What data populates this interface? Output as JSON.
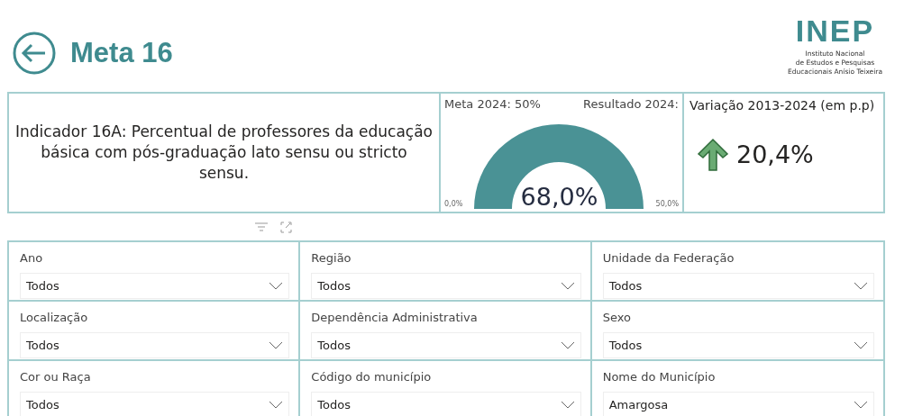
{
  "header": {
    "title": "Meta 16",
    "logo": "INEP",
    "institute": [
      "Instituto Nacional",
      "de Estudos e Pesquisas",
      "Educacionais Anísio Teixeira"
    ]
  },
  "indicator": {
    "text": "Indicador 16A: Percentual de professores da educação básica com pós-graduação lato sensu ou stricto sensu."
  },
  "gauge": {
    "target_label": "Meta 2024: 50%",
    "result_label": "Resultado 2024:",
    "value": "68,0%",
    "min": "0,0%",
    "max": "50,0%",
    "level": 1
  },
  "variation": {
    "title": "Variação 2013-2024 (em p.p)",
    "rising": true,
    "value": "20,4%"
  },
  "filters": [
    {
      "label": "Ano",
      "value": "Todos"
    },
    {
      "label": "Região",
      "value": "Todos"
    },
    {
      "label": "Unidade da Federação",
      "value": "Todos"
    },
    {
      "label": "Localização",
      "value": "Todos"
    },
    {
      "label": "Dependência Administrativa",
      "value": "Todos"
    },
    {
      "label": "Sexo",
      "value": "Todos"
    },
    {
      "label": "Cor ou Raça",
      "value": "Todos"
    },
    {
      "label": "Código do município",
      "value": "Todos"
    },
    {
      "label": "Nome do Município",
      "value": "Amargosa"
    }
  ]
}
